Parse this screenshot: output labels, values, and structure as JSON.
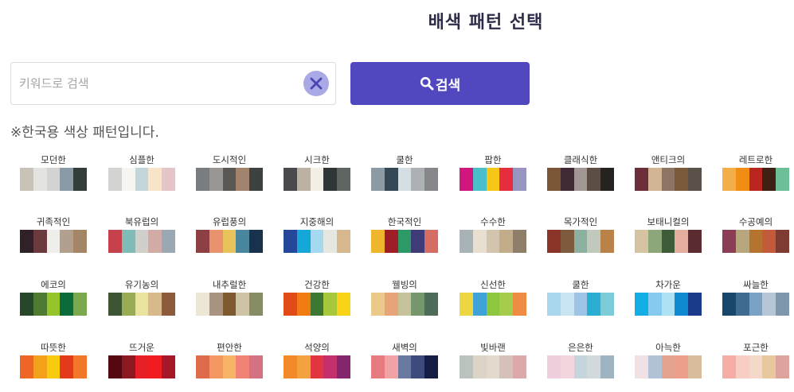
{
  "title": "배색 패턴 선택",
  "search": {
    "placeholder": "키워드로 검색",
    "value": "",
    "button_label": "검색"
  },
  "notice": "※한국용 색상 패턴입니다.",
  "palettes": [
    {
      "label": "모던한",
      "colors": [
        "#c8c3b6",
        "#e3e3e0",
        "#d3d3d3",
        "#8a9aa6",
        "#333d3a"
      ]
    },
    {
      "label": "심플한",
      "colors": [
        "#d5d3d2",
        "#f5f5f2",
        "#c5d6da",
        "#f8e4c9",
        "#e5c5c8"
      ]
    },
    {
      "label": "도시적인",
      "colors": [
        "#7a7d80",
        "#9a9694",
        "#5a5755",
        "#a0826d",
        "#3d4241"
      ]
    },
    {
      "label": "시크한",
      "colors": [
        "#4a4a4e",
        "#bbb2a4",
        "#f3efe4",
        "#303636",
        "#5f6561"
      ]
    },
    {
      "label": "쿨한",
      "colors": [
        "#8c9ba3",
        "#354855",
        "#d5dee2",
        "#adb1b3",
        "#87868a"
      ]
    },
    {
      "label": "팝한",
      "colors": [
        "#d1167e",
        "#4bbecc",
        "#f6c616",
        "#e62d3d",
        "#9896c1"
      ]
    },
    {
      "label": "클래식한",
      "colors": [
        "#7a5536",
        "#3f2a35",
        "#a19894",
        "#5d4d45",
        "#252220"
      ]
    },
    {
      "label": "앤티크의",
      "colors": [
        "#6c2e38",
        "#d2b595",
        "#8e7462",
        "#7a5a3b",
        "#595047"
      ]
    },
    {
      "label": "레트로한",
      "colors": [
        "#f4ae48",
        "#f18c14",
        "#b8261e",
        "#3e2114",
        "#6cbf96"
      ]
    },
    {
      "label": "귀족적인",
      "colors": [
        "#302128",
        "#6b3a3f",
        "#f0eeeb",
        "#b2a08f",
        "#a48566"
      ]
    },
    {
      "label": "북유럽의",
      "colors": [
        "#c6414b",
        "#7fbcb8",
        "#cfcfcc",
        "#d1aca7",
        "#99a8b3"
      ]
    },
    {
      "label": "유럽풍의",
      "colors": [
        "#8c4043",
        "#e8936d",
        "#e8c25b",
        "#4a879f",
        "#18324e"
      ]
    },
    {
      "label": "지중해의",
      "colors": [
        "#24479a",
        "#16a7d9",
        "#a5d9ef",
        "#e7e7e1",
        "#d6b78e"
      ]
    },
    {
      "label": "한국적인",
      "colors": [
        "#eeb52d",
        "#9e1d26",
        "#2d9967",
        "#3d3c78",
        "#d46e64"
      ]
    },
    {
      "label": "수수한",
      "colors": [
        "#a8b3b8",
        "#e8dfd0",
        "#d3c4ae",
        "#c2ac8a",
        "#8f7f6a"
      ]
    },
    {
      "label": "목가적인",
      "colors": [
        "#8b3428",
        "#7f5a3c",
        "#8cb1a1",
        "#c0c9bc",
        "#b88249"
      ]
    },
    {
      "label": "보태니컬의",
      "colors": [
        "#d5c3a2",
        "#8ca87a",
        "#3e5c37",
        "#e4ad9e",
        "#5b2b2f"
      ]
    },
    {
      "label": "수공예의",
      "colors": [
        "#8a3d55",
        "#b8a67e",
        "#b4732e",
        "#c35a3a",
        "#7d3b31"
      ]
    },
    {
      "label": "에코의",
      "colors": [
        "#27472b",
        "#4f7a32",
        "#96c42b",
        "#0c6b3b",
        "#7ba84f"
      ]
    },
    {
      "label": "유기농의",
      "colors": [
        "#3e5533",
        "#9aab55",
        "#e8e4a0",
        "#d7b98c",
        "#8c5b3c"
      ]
    },
    {
      "label": "내추럴한",
      "colors": [
        "#ebe6d6",
        "#a89480",
        "#7d5a30",
        "#d0c4a6",
        "#868c63"
      ]
    },
    {
      "label": "건강한",
      "colors": [
        "#e14c16",
        "#f17d12",
        "#3c7733",
        "#a8c83c",
        "#f8d316"
      ]
    },
    {
      "label": "웰빙의",
      "colors": [
        "#eac98b",
        "#e8a479",
        "#c6c39a",
        "#76966d",
        "#4e6d58"
      ]
    },
    {
      "label": "신선한",
      "colors": [
        "#edd741",
        "#3fa3d8",
        "#8dc73f",
        "#a5cc4c",
        "#ef8c44"
      ]
    },
    {
      "label": "쿨한",
      "colors": [
        "#a7d6ed",
        "#c8e3f2",
        "#9dc3e7",
        "#2aafd2",
        "#7ccbd8"
      ]
    },
    {
      "label": "차가운",
      "colors": [
        "#13aee5",
        "#86cbef",
        "#ade1f4",
        "#0f89d2",
        "#1a3a8b"
      ]
    },
    {
      "label": "싸늘한",
      "colors": [
        "#17486b",
        "#3e6b8f",
        "#7ba2c4",
        "#b6c6d6",
        "#7e97ad"
      ]
    },
    {
      "label": "따뜻한",
      "colors": [
        "#ef6525",
        "#f3a01b",
        "#f8cb0f",
        "#e43a1a",
        "#f1772a"
      ]
    },
    {
      "label": "뜨거운",
      "colors": [
        "#560810",
        "#8c1920",
        "#e71f26",
        "#f01c20",
        "#a61828"
      ]
    },
    {
      "label": "편안한",
      "colors": [
        "#dd6b4c",
        "#f39861",
        "#f7b466",
        "#f18276",
        "#d47284"
      ]
    },
    {
      "label": "석양의",
      "colors": [
        "#f38a2a",
        "#f2a23e",
        "#e13640",
        "#c42f6d",
        "#84266e"
      ]
    },
    {
      "label": "새벽의",
      "colors": [
        "#e67a80",
        "#f0a2a4",
        "#6a79a0",
        "#3c4b7b",
        "#151d45"
      ]
    },
    {
      "label": "빛바랜",
      "colors": [
        "#bac3bd",
        "#ddd4c8",
        "#e2dacb",
        "#d6c1ba",
        "#dba9aa"
      ]
    },
    {
      "label": "은은한",
      "colors": [
        "#efcfdd",
        "#f3d5de",
        "#c5d5dc",
        "#d2d9dd",
        "#9eb5c1"
      ]
    },
    {
      "label": "아늑한",
      "colors": [
        "#f1e1e4",
        "#b1c2d6",
        "#e4a28f",
        "#ec9f8b",
        "#d8bd9c"
      ]
    },
    {
      "label": "포근한",
      "colors": [
        "#f4aea5",
        "#f8cec4",
        "#f4d9c8",
        "#e9c89e",
        "#dfa39d"
      ]
    }
  ],
  "icons": {
    "clear": "close-icon",
    "search": "magnifier-icon"
  },
  "colors": {
    "accent": "#5147bf",
    "clear_bg": "#a9a9e6",
    "title": "#2d2d4a"
  }
}
